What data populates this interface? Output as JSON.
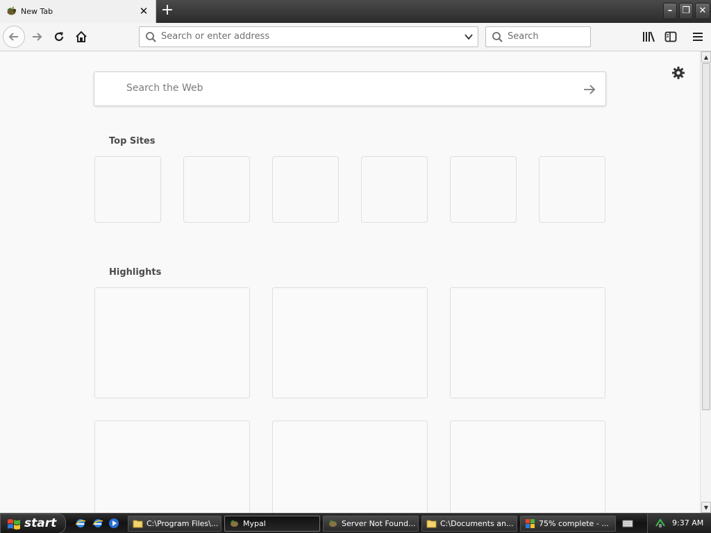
{
  "browser": {
    "tab": {
      "title": "New Tab",
      "close_label": "✕"
    },
    "newtab_label": "+",
    "window_controls": {
      "minimize": "–",
      "restore": "❐",
      "close": "✕"
    },
    "address_bar": {
      "placeholder": "Search or enter address",
      "value": ""
    },
    "search_bar": {
      "placeholder": "Search",
      "value": ""
    }
  },
  "newtab": {
    "web_search": {
      "placeholder": "Search the Web",
      "value": ""
    },
    "top_sites": {
      "title": "Top Sites",
      "tile_count": 6
    },
    "highlights": {
      "title": "Highlights",
      "card_count": 6
    }
  },
  "taskbar": {
    "start_label": "start",
    "quick_launch": [
      "ie-icon",
      "ie-icon",
      "media-player-icon"
    ],
    "tasks": [
      {
        "label": "C:\\Program Files\\...",
        "icon": "folder-icon",
        "active": false
      },
      {
        "label": "Mypal",
        "icon": "mypal-icon",
        "active": true
      },
      {
        "label": "Server Not Found...",
        "icon": "mypal-icon",
        "active": false
      },
      {
        "label": "C:\\Documents an...",
        "icon": "folder-icon",
        "active": false
      },
      {
        "label": "75% complete - ...",
        "icon": "windows-icon",
        "active": false
      }
    ],
    "clock": "9:37 AM"
  },
  "colors": {
    "tabstrip": "#2b2b2b",
    "toolbar": "#f5f5f5",
    "content_bg": "#f9f9f9",
    "tile_border": "#dedede",
    "taskbar": "#1a1a1a"
  }
}
